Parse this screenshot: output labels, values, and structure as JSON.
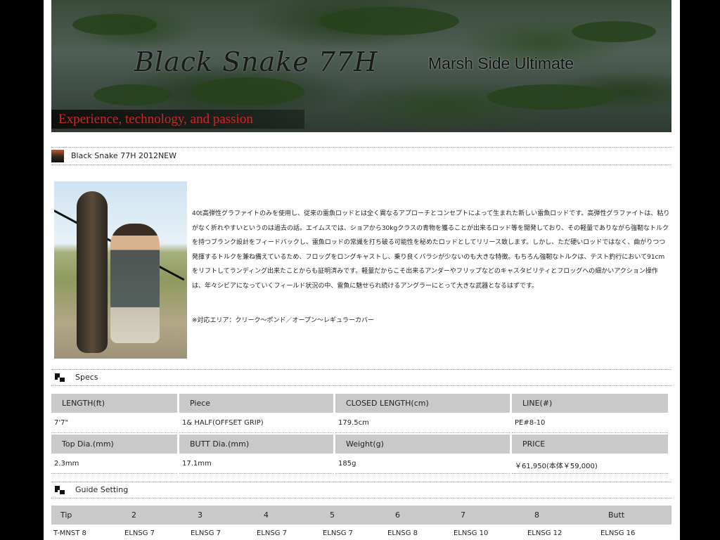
{
  "banner": {
    "title": "Black Snake 77H",
    "subtitle": "Marsh Side Ultimate",
    "tagline": "Experience, technology, and passion"
  },
  "product_header": {
    "title": "Black Snake 77H 2012NEW"
  },
  "description": {
    "body": "40t高弾性グラファイトのみを使用し、従来の雷魚ロッドとは全く異なるアプローチとコンセプトによって生まれた新しい雷魚ロッドです。高弾性グラファイトは、粘りがなく折れやすいというのは過去の話。エイムスでは、ショアから30kgクラスの青物を獲ることが出来るロッド等を開発しており、その軽量でありながら強靭なトルクを持つブランク設計をフィードバックし、雷魚ロッドの常識を打ち破る可能性を秘めたロッドとしてリリース致します。しかし、ただ硬いロッドではなく、曲がりつつ発揮するトルクを兼ね備えているため、フロッグをロングキャストし、乗り良くバラシが少ないのも大きな特徴。もちろん強靭なトルクは、テスト釣行において91cmをリフトしてランディング出来たことからも証明済みです。軽量だからこそ出来るアンダーやフリップなどのキャスタビリティとフロッグへの細かいアクション操作は、年々シビアになっていくフィールド状況の中、雷魚に魅せられ続けるアングラーにとって大きな武器となるはずです。",
    "note": "※対応エリア：クリーク〜ポンド／オープン〜レギュラーカバー"
  },
  "specs": {
    "heading": "Specs",
    "row1_headers": [
      "LENGTH(ft)",
      "Piece",
      "CLOSED LENGTH(cm)",
      "LINE(#)"
    ],
    "row1_values": [
      "7'7\"",
      "1& HALF(OFFSET GRIP)",
      "179.5cm",
      "PE#8-10"
    ],
    "row2_headers": [
      "Top Dia.(mm)",
      "BUTT Dia.(mm)",
      "Weight(g)",
      "PRICE"
    ],
    "row2_values": [
      "2.3mm",
      "17.1mm",
      "185g",
      "￥61,950(本体￥59,000)"
    ]
  },
  "guide": {
    "heading": "Guide Setting",
    "headers": [
      "Tip",
      "2",
      "3",
      "4",
      "5",
      "6",
      "7",
      "8",
      "Butt"
    ],
    "values": [
      "T-MNST 8",
      "ELNSG 7",
      "ELNSG 7",
      "ELNSG 7",
      "ELNSG 7",
      "ELNSG 8",
      "ELNSG 10",
      "ELNSG 12",
      "ELNSG 16"
    ]
  },
  "colors": {
    "background": "#000000",
    "page": "#ffffff",
    "header_cell": "#c9c9c9",
    "tagline": "#c8282a"
  }
}
